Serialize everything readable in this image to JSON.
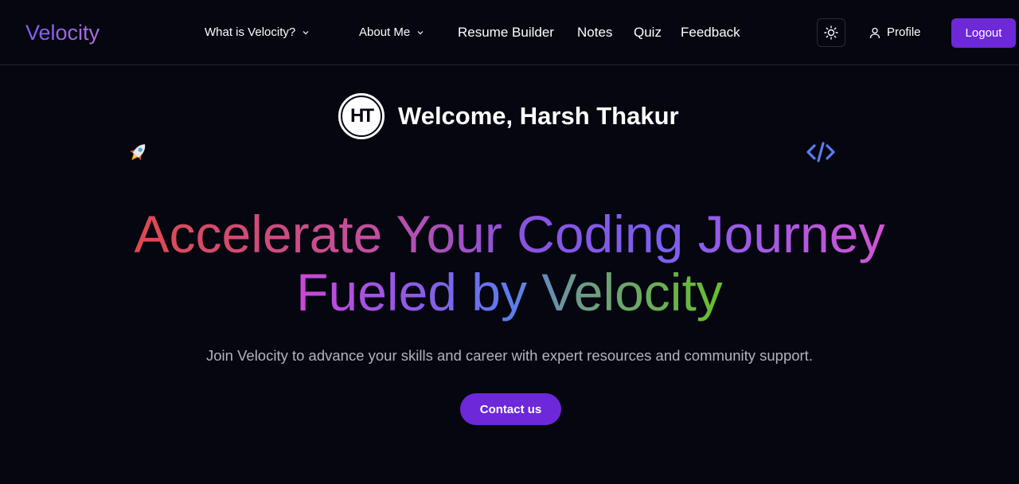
{
  "navbar": {
    "brand": "Velocity",
    "links": [
      {
        "label": "What is Velocity?",
        "has_dropdown": true
      },
      {
        "label": "About Me",
        "has_dropdown": true
      },
      {
        "label": "Resume Builder",
        "has_dropdown": false
      },
      {
        "label": "Notes",
        "has_dropdown": false
      },
      {
        "label": "Quiz",
        "has_dropdown": false
      },
      {
        "label": "Feedback",
        "has_dropdown": false
      }
    ],
    "theme_toggle_icon": "sun-icon",
    "profile_icon": "user-icon",
    "profile_label": "Profile",
    "logout_label": "Logout"
  },
  "hero": {
    "avatar_initials": "HT",
    "welcome_text": "Welcome, Harsh Thakur",
    "headline_line1": "Accelerate Your Coding Journey",
    "headline_line2": "Fueled by Velocity",
    "subtitle": "Join Velocity to advance your skills and career with expert resources and community support.",
    "cta_label": "Contact us",
    "decor_left_icon": "rocket-icon",
    "decor_right_icon": "code-icon"
  },
  "colors": {
    "background": "#05060f",
    "accent": "#6d28d9",
    "brand_gradient_start": "#7f5cf0",
    "brand_gradient_end": "#b06ee0",
    "code_icon": "#5b7cf0"
  }
}
